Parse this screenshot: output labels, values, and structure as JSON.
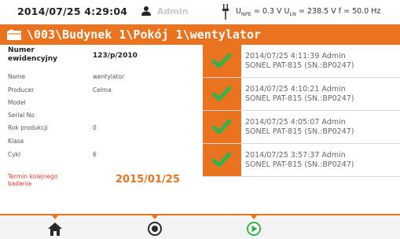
{
  "status_bar": {
    "datetime": "2014/07/25 4:29:04",
    "user": "Admin",
    "measurements": {
      "upe_label": "U",
      "upe_sub": "NPE",
      "upe_value": " = 0.3 V",
      "uln_label": "U",
      "uln_sub": "LN",
      "uln_value": " = 238.5 V",
      "freq": "f = 50.0 Hz"
    }
  },
  "title": {
    "path": "\\003\\Budynek 1\\Pokój 1\\wentylator"
  },
  "details": {
    "number_label_1": "Numer",
    "number_label_2": "ewidencyjny",
    "number_value": "123/p/2010",
    "name_label": "Name",
    "name_value": "wentylator",
    "producer_label": "Producer",
    "producer_value": "Celma",
    "model_label": "Model",
    "serial_label": "Serial No",
    "year_label": "Rok produkcji",
    "year_value": "0",
    "class_label": "Klasa",
    "cycles_label": "Cykl",
    "cycles_value": "6",
    "next_test_label_1": "Termin kolejnego",
    "next_test_label_2": "badania",
    "next_test_value": "2015/01/25"
  },
  "measurements": [
    {
      "line1": "2014/07/25 4:11:39   Admin",
      "line2": "SONEL PAT-815 (SN.:BP0247)"
    },
    {
      "line1": "2014/07/25 4:10:21   Admin",
      "line2": "SONEL PAT-815 (SN.:BP0247)"
    },
    {
      "line1": "2014/07/25 4:05:07   Admin",
      "line2": "SONEL PAT-815 (SN.:BP0247)"
    },
    {
      "line1": "2014/07/25 3:57:37   Admin",
      "line2": "SONEL PAT-815 (SN.:BP0247)"
    }
  ],
  "icons": {
    "status_user": "person-icon",
    "status_plug": "plug-icon",
    "title": "folder-icon",
    "check": "checkmark-icon",
    "nav": [
      "home-icon",
      "record-icon",
      "play-icon"
    ]
  },
  "colors": {
    "accent": "#e9731f",
    "check": "#35b24a",
    "date_highlight": "#e9731f",
    "warning_text": "#e23a2e"
  }
}
